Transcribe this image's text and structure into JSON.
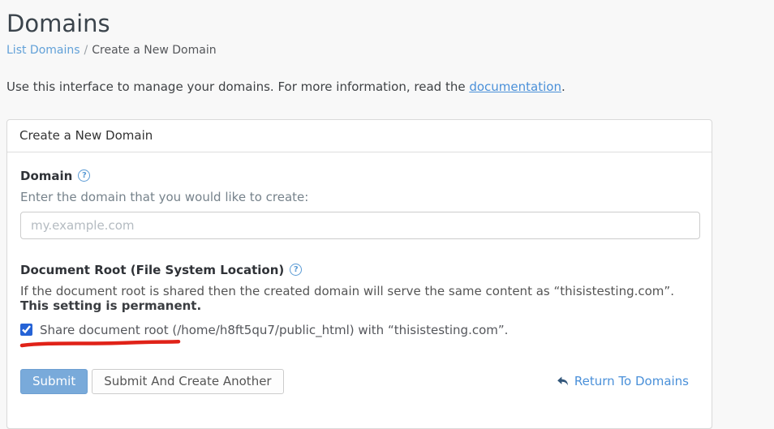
{
  "page": {
    "title": "Domains",
    "breadcrumb": {
      "link": "List Domains",
      "separator": "/",
      "current": "Create a New Domain"
    },
    "intro": {
      "text_before": "Use this interface to manage your domains. For more information, read the ",
      "link": "documentation",
      "text_after": "."
    }
  },
  "panel": {
    "heading": "Create a New Domain",
    "domain_field": {
      "label": "Domain",
      "help_icon": "?",
      "hint": "Enter the domain that you would like to create:",
      "value": "",
      "placeholder": "my.example.com"
    },
    "docroot_field": {
      "label": "Document Root (File System Location)",
      "help_icon": "?",
      "description_text": "If the document root is shared then the created domain will serve the same content as “thisistesting.com”. ",
      "description_bold": "This setting is permanent.",
      "checkbox": {
        "checked": true,
        "label": "Share document root (/home/h8ft5qu7/public_html) with “thisistesting.com”."
      }
    },
    "actions": {
      "submit": "Submit",
      "submit_create_another": "Submit And Create Another",
      "return_link": "Return To Domains"
    }
  },
  "colors": {
    "page_background": "#f8f8f8",
    "panel_background": "#ffffff",
    "link_blue": "#4a90d9",
    "breadcrumb_link_blue": "#62a1d8",
    "primary_button_blue": "#79aada",
    "checkbox_blue": "#2563d6",
    "annotation_red": "#e02218",
    "reply_icon_navy": "#33577b"
  }
}
